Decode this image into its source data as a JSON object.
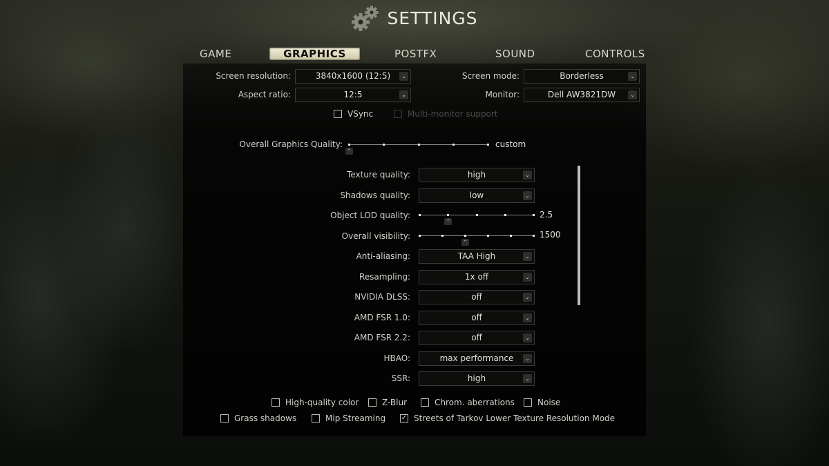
{
  "header": {
    "title": "SETTINGS",
    "icon": "gears-icon"
  },
  "tabs": [
    {
      "label": "GAME",
      "active": false
    },
    {
      "label": "GRAPHICS",
      "active": true
    },
    {
      "label": "POSTFX",
      "active": false
    },
    {
      "label": "SOUND",
      "active": false
    },
    {
      "label": "CONTROLS",
      "active": false
    }
  ],
  "display": {
    "screen_resolution": {
      "label": "Screen resolution:",
      "value": "3840x1600 (12:5)"
    },
    "aspect_ratio": {
      "label": "Aspect ratio:",
      "value": "12:5"
    },
    "screen_mode": {
      "label": "Screen mode:",
      "value": "Borderless"
    },
    "monitor": {
      "label": "Monitor:",
      "value": "Dell AW3821DW"
    },
    "vsync": {
      "label": "VSync",
      "checked": false
    },
    "multi_monitor": {
      "label": "Multi-monitor support",
      "checked": false,
      "disabled": true
    }
  },
  "overall_quality": {
    "label": "Overall Graphics Quality:",
    "value": "custom",
    "steps": 5,
    "position": 0
  },
  "settings": {
    "texture_quality": {
      "label": "Texture quality:",
      "value": "high"
    },
    "shadows_quality": {
      "label": "Shadows quality:",
      "value": "low"
    },
    "object_lod": {
      "label": "Object LOD quality:",
      "value": "2.5",
      "steps": 5,
      "position_fraction": 0.25
    },
    "overall_visibility": {
      "label": "Overall visibility:",
      "value": "1500",
      "steps": 6,
      "position_fraction": 0.4
    },
    "anti_aliasing": {
      "label": "Anti-aliasing:",
      "value": "TAA High"
    },
    "resampling": {
      "label": "Resampling:",
      "value": "1x off"
    },
    "nvidia_dlss": {
      "label": "NVIDIA DLSS:",
      "value": "off"
    },
    "amd_fsr_10": {
      "label": "AMD FSR 1.0:",
      "value": "off"
    },
    "amd_fsr_22": {
      "label": "AMD FSR 2.2:",
      "value": "off"
    },
    "hbao": {
      "label": "HBAO:",
      "value": "max performance"
    },
    "ssr": {
      "label": "SSR:",
      "value": "high"
    }
  },
  "checkboxes": {
    "high_quality_color": {
      "label": "High-quality color",
      "checked": false
    },
    "z_blur": {
      "label": "Z-Blur",
      "checked": false
    },
    "chrom_aberrations": {
      "label": "Chrom. aberrations",
      "checked": false
    },
    "noise": {
      "label": "Noise",
      "checked": false
    },
    "grass_shadows": {
      "label": "Grass shadows",
      "checked": false
    },
    "mip_streaming": {
      "label": "Mip Streaming",
      "checked": false
    },
    "streets_lower_texture": {
      "label": "Streets of Tarkov Lower Texture Resolution Mode",
      "checked": true
    }
  }
}
